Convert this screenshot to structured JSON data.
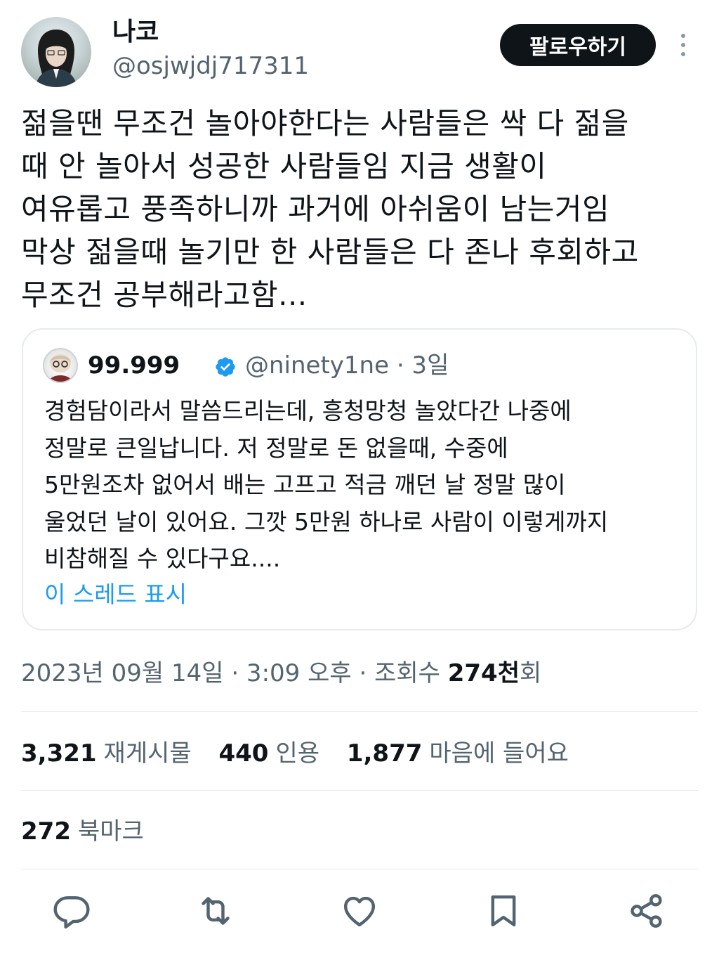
{
  "author": {
    "display_name": "나코",
    "handle": "@osjwjdj717311"
  },
  "follow_label": "팔로우하기",
  "tweet_text": "젊을땐 무조건 놀아야한다는 사람들은 싹 다  젊을\n때 안 놀아서 성공한 사람들임 지금 생활이\n여유롭고 풍족하니까 과거에 아쉬움이 남는거임\n막상 젊을때 놀기만 한 사람들은 다 존나 후회하고\n무조건 공부해라고함...",
  "quote": {
    "name": "99.999",
    "handle_time": "@ninety1ne · 3일",
    "text": "경험담이라서 말씀드리는데, 흥청망청 놀았다간 나중에\n정말로 큰일납니다. 저 정말로 돈 없을때, 수중에\n5만원조차 없어서 배는 고프고 적금 깨던 날 정말 많이\n울었던 날이 있어요. 그깟 5만원 하나로 사람이 이렇게까지\n비참해질 수 있다구요....",
    "show_thread": "이 스레드 표시"
  },
  "meta": {
    "datetime": "2023년 09월 14일 · 3:09 오후 · 조회수 ",
    "views": "274천",
    "views_suffix": "회"
  },
  "stats": {
    "retweets": "3,321",
    "retweets_label": "재게시물",
    "quotes": "440",
    "quotes_label": "인용",
    "likes": "1,877",
    "likes_label": "마음에 들어요"
  },
  "bookmarks": {
    "count": "272",
    "label": "북마크"
  },
  "icons": {
    "reply": "reply-icon",
    "retweet": "retweet-icon",
    "like": "heart-icon",
    "bookmark": "bookmark-icon",
    "share": "share-icon",
    "verified": "verified-badge-icon"
  },
  "colors": {
    "text": "#0f1419",
    "secondary": "#536471",
    "link": "#1d9bf0",
    "verified": "#1d9bf0",
    "divider": "#e6ebef"
  }
}
